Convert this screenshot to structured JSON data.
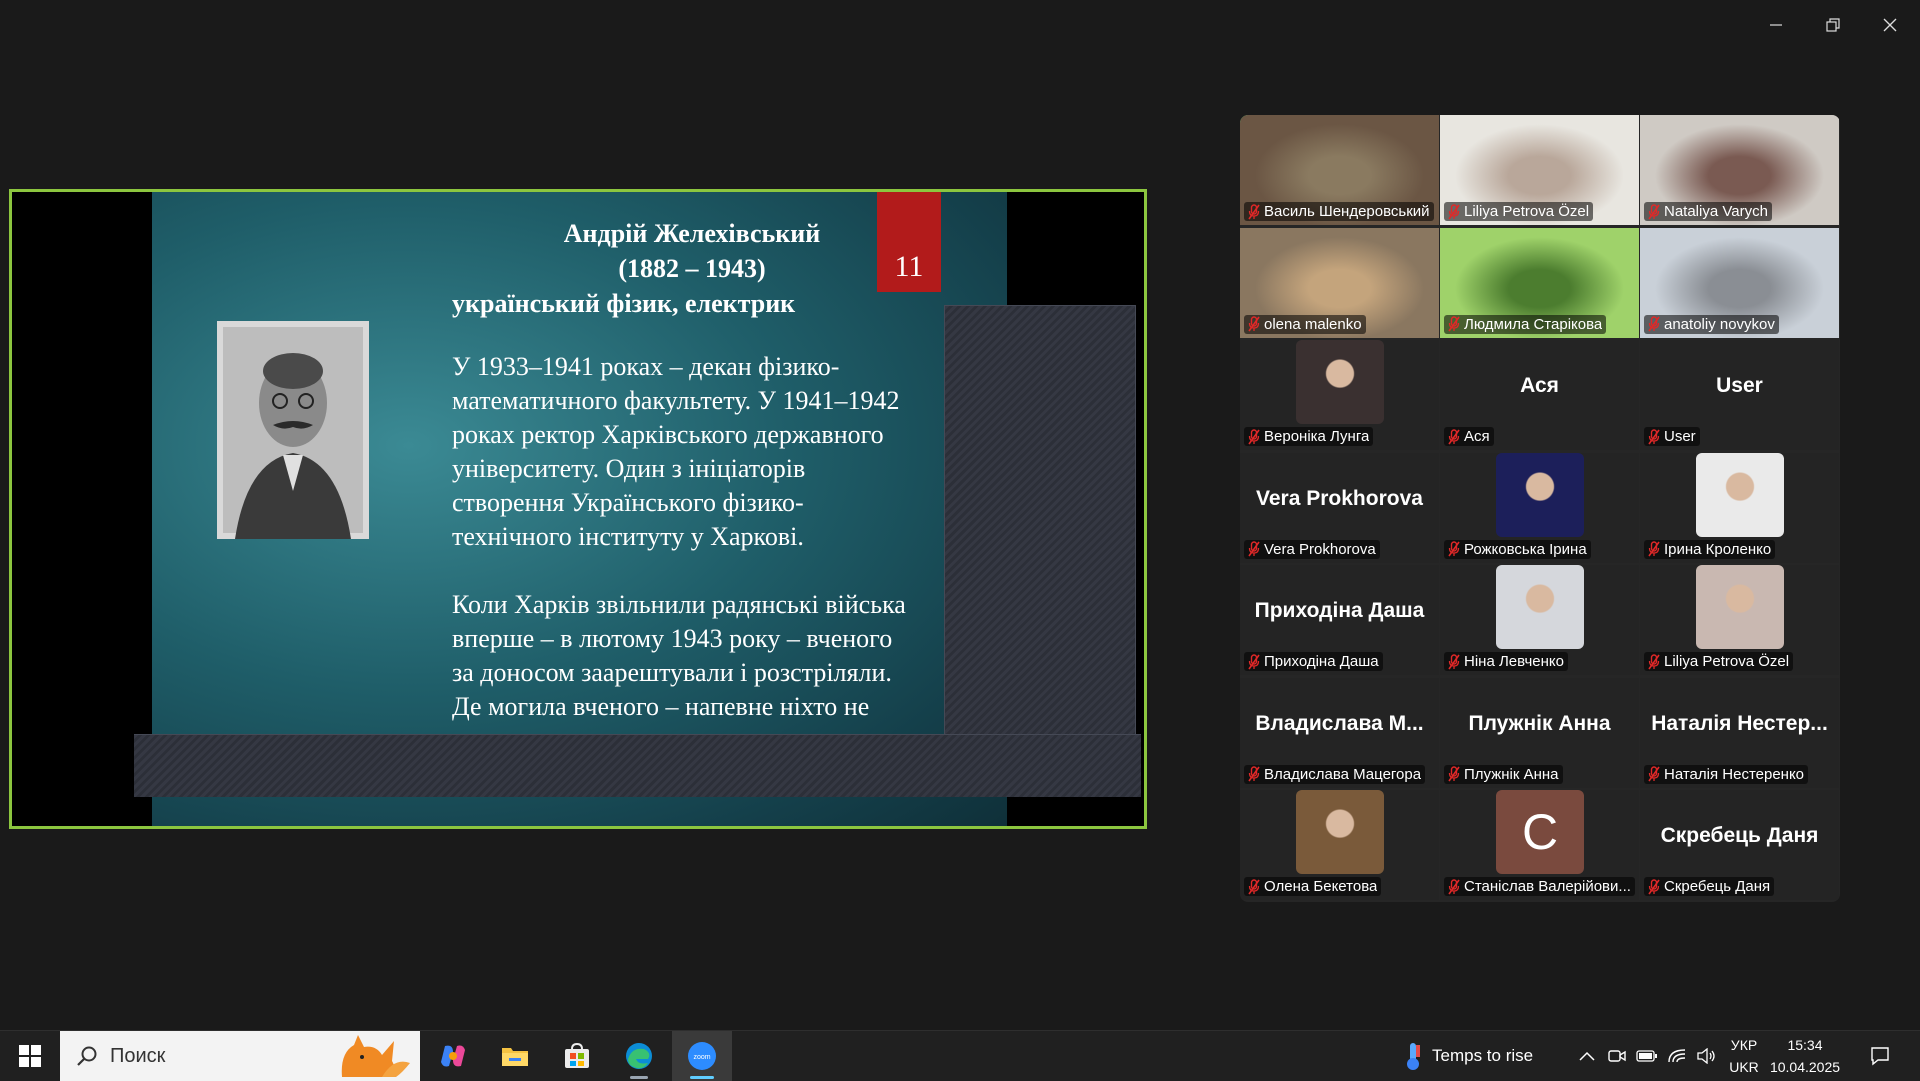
{
  "window": {
    "minimize": "minimize",
    "maximize": "restore",
    "close": "close"
  },
  "slide": {
    "number": "11",
    "title_line1": "Андрій Желехівський",
    "title_line2": "(1882 – 1943)",
    "title_line3": "український фізик, електрик",
    "para1": [
      "У 1933–1941 роках  – декан фізико-",
      "математичного факультету. У 1941–1942",
      "роках ректор Харківського державного",
      "університету. Один з ініціаторів",
      "створення Українського фізико-",
      "технічного інституту у Харкові."
    ],
    "para2": [
      "Коли Харків звільнили радянські війська",
      "вперше – в лютому 1943 року – вченого",
      "за доносом заарештували і розстріляли.",
      "Де могила вченого – напевне ніхто не"
    ]
  },
  "participants": [
    {
      "label": "Василь Шендеровський",
      "video": true,
      "active": true
    },
    {
      "label": "Liliya Petrova Özel",
      "video": true
    },
    {
      "label": "Nataliya Varych",
      "video": true
    },
    {
      "label": "olena malenko",
      "video": true
    },
    {
      "label": "Людмила Старікова",
      "video": true
    },
    {
      "label": "anatoliy novykov",
      "video": true
    },
    {
      "label": "Вероніка Лунга",
      "avatar": true
    },
    {
      "label": "Ася",
      "big": "Ася"
    },
    {
      "label": "User",
      "big": "User"
    },
    {
      "label": "Vera Prokhorova",
      "big": "Vera Prokhorova"
    },
    {
      "label": "Рожковська Ірина",
      "avatar": true
    },
    {
      "label": "Ірина Кроленко",
      "avatar": true
    },
    {
      "label": "Приходіна Даша",
      "big": "Приходіна Даша"
    },
    {
      "label": "Ніна Левченко",
      "avatar": true
    },
    {
      "label": "Liliya Petrova Özel",
      "avatar": true
    },
    {
      "label": "Владислава Мацегора",
      "big": "Владислава  М..."
    },
    {
      "label": "Плужнік Анна",
      "big": "Плужнік Анна"
    },
    {
      "label": "Наталія Нестеренко",
      "big": "Наталія  Нестер..."
    },
    {
      "label": "Олена Бекетова",
      "avatar": true
    },
    {
      "label": "Станіслав Валерійови...",
      "letter": "C"
    },
    {
      "label": "Скребець Даня",
      "big": "Скребець Даня"
    }
  ],
  "taskbar": {
    "search_placeholder": "Поиск",
    "weather": "Temps to rise",
    "lang_top": "УКР",
    "lang_bottom": "UKR",
    "time": "15:34",
    "date": "10.04.2025"
  },
  "colors": {
    "accent_green": "#8cc63f",
    "active_speaker": "#23d96a",
    "muted_red": "#e02828",
    "slide_number_bg": "#b21b1b"
  }
}
